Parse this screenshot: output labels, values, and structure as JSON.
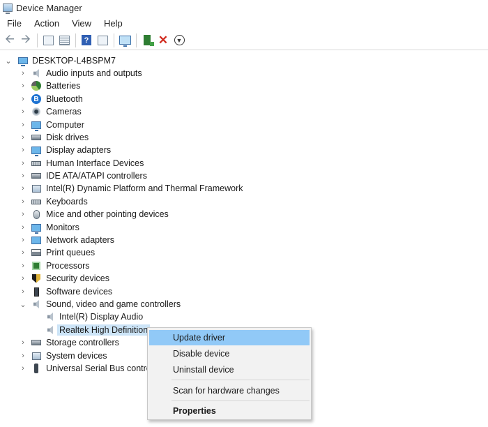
{
  "window": {
    "title": "Device Manager"
  },
  "menu": [
    "File",
    "Action",
    "View",
    "Help"
  ],
  "toolbar": [
    {
      "name": "back-icon"
    },
    {
      "name": "forward-icon"
    },
    {
      "name": "properties-icon"
    },
    {
      "name": "show-hidden-icon"
    },
    {
      "name": "help-icon"
    },
    {
      "name": "view-icon"
    },
    {
      "name": "scan-monitor-icon"
    },
    {
      "name": "add-driver-icon"
    },
    {
      "name": "uninstall-icon"
    },
    {
      "name": "download-icon"
    }
  ],
  "tree": {
    "root": "DESKTOP-L4BSPM7",
    "categories": [
      {
        "label": "Audio inputs and outputs",
        "icon": "speaker-icon"
      },
      {
        "label": "Batteries",
        "icon": "battery-icon"
      },
      {
        "label": "Bluetooth",
        "icon": "bluetooth-icon"
      },
      {
        "label": "Cameras",
        "icon": "camera-icon"
      },
      {
        "label": "Computer",
        "icon": "computer-icon"
      },
      {
        "label": "Disk drives",
        "icon": "disk-drive-icon"
      },
      {
        "label": "Display adapters",
        "icon": "display-adapter-icon"
      },
      {
        "label": "Human Interface Devices",
        "icon": "keyboard-icon"
      },
      {
        "label": "IDE ATA/ATAPI controllers",
        "icon": "ide-controller-icon"
      },
      {
        "label": "Intel(R) Dynamic Platform and Thermal Framework",
        "icon": "device-icon"
      },
      {
        "label": "Keyboards",
        "icon": "keyboard-icon"
      },
      {
        "label": "Mice and other pointing devices",
        "icon": "mouse-icon"
      },
      {
        "label": "Monitors",
        "icon": "monitor-icon"
      },
      {
        "label": "Network adapters",
        "icon": "network-adapter-icon"
      },
      {
        "label": "Print queues",
        "icon": "printer-icon"
      },
      {
        "label": "Processors",
        "icon": "processor-icon"
      },
      {
        "label": "Security devices",
        "icon": "security-device-icon"
      },
      {
        "label": "Software devices",
        "icon": "software-device-icon"
      },
      {
        "label": "Sound, video and game controllers",
        "icon": "speaker-icon",
        "expanded": true,
        "children": [
          {
            "label": "Intel(R) Display Audio",
            "icon": "speaker-icon"
          },
          {
            "label": "Realtek High Definition",
            "icon": "speaker-icon",
            "selected": true
          }
        ]
      },
      {
        "label": "Storage controllers",
        "icon": "storage-controller-icon"
      },
      {
        "label": "System devices",
        "icon": "system-device-icon"
      },
      {
        "label": "Universal Serial Bus controll",
        "icon": "usb-icon"
      }
    ]
  },
  "context_menu": {
    "items": [
      {
        "label": "Update driver",
        "highlighted": true
      },
      {
        "label": "Disable device"
      },
      {
        "label": "Uninstall device"
      },
      {
        "label": "Scan for hardware changes"
      },
      {
        "label": "Properties",
        "bold": true
      }
    ]
  },
  "colors": {
    "selection": "#cce4f7",
    "menu_highlight": "#91c9f7",
    "delete": "#d12b1f"
  }
}
